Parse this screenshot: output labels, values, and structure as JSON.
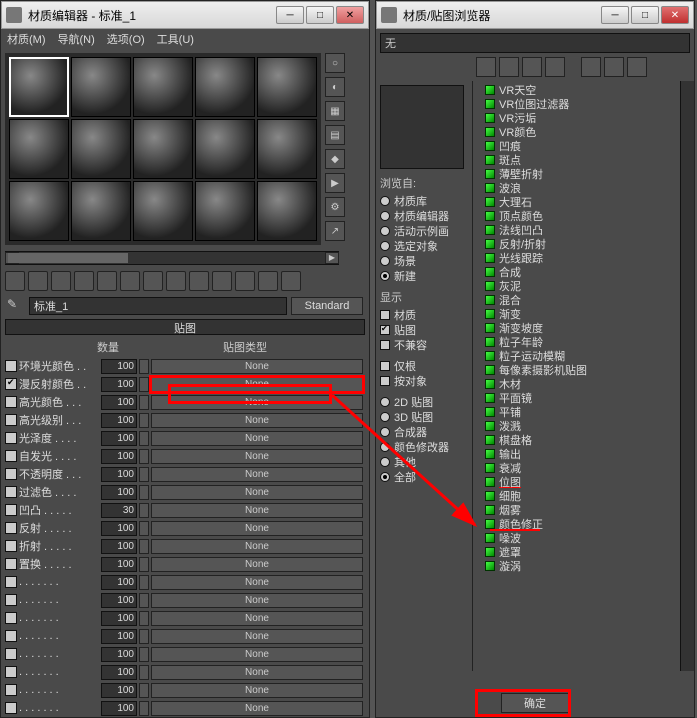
{
  "left": {
    "title": "材质编辑器 - 标准_1",
    "menus": [
      "材质(M)",
      "导航(N)",
      "选项(O)",
      "工具(U)"
    ],
    "material_name": "标准_1",
    "shader_button": "Standard",
    "section": "贴图",
    "col_amount": "数量",
    "col_type": "贴图类型",
    "maps": [
      {
        "label": "环境光颜色 . .",
        "amount": "100",
        "type": "None",
        "checked": false
      },
      {
        "label": "漫反射颜色 . .",
        "amount": "100",
        "type": "None",
        "checked": true,
        "highlight": true
      },
      {
        "label": "高光颜色 . . .",
        "amount": "100",
        "type": "None",
        "checked": false
      },
      {
        "label": "高光级别 . . .",
        "amount": "100",
        "type": "None",
        "checked": false
      },
      {
        "label": "光泽度 . . . .",
        "amount": "100",
        "type": "None",
        "checked": false
      },
      {
        "label": "自发光 . . . .",
        "amount": "100",
        "type": "None",
        "checked": false
      },
      {
        "label": "不透明度 . . .",
        "amount": "100",
        "type": "None",
        "checked": false
      },
      {
        "label": "过滤色 . . . .",
        "amount": "100",
        "type": "None",
        "checked": false
      },
      {
        "label": "凹凸 . . . . .",
        "amount": "30",
        "type": "None",
        "checked": false
      },
      {
        "label": "反射 . . . . .",
        "amount": "100",
        "type": "None",
        "checked": false
      },
      {
        "label": "折射 . . . . .",
        "amount": "100",
        "type": "None",
        "checked": false
      },
      {
        "label": "置换 . . . . .",
        "amount": "100",
        "type": "None",
        "checked": false
      },
      {
        "label": ". . . . . . .",
        "amount": "100",
        "type": "None",
        "checked": false
      },
      {
        "label": ". . . . . . .",
        "amount": "100",
        "type": "None",
        "checked": false
      },
      {
        "label": ". . . . . . .",
        "amount": "100",
        "type": "None",
        "checked": false
      },
      {
        "label": ". . . . . . .",
        "amount": "100",
        "type": "None",
        "checked": false
      },
      {
        "label": ". . . . . . .",
        "amount": "100",
        "type": "None",
        "checked": false
      },
      {
        "label": ". . . . . . .",
        "amount": "100",
        "type": "None",
        "checked": false
      },
      {
        "label": ". . . . . . .",
        "amount": "100",
        "type": "None",
        "checked": false
      },
      {
        "label": ". . . . . . .",
        "amount": "100",
        "type": "None",
        "checked": false
      }
    ]
  },
  "right": {
    "title": "材质/贴图浏览器",
    "search": "无",
    "browse_from": {
      "header": "浏览自:",
      "options": [
        {
          "label": "材质库",
          "on": false
        },
        {
          "label": "材质编辑器",
          "on": false
        },
        {
          "label": "活动示例画",
          "on": false
        },
        {
          "label": "选定对象",
          "on": false
        },
        {
          "label": "场景",
          "on": false
        },
        {
          "label": "新建",
          "on": true
        }
      ]
    },
    "show": {
      "header": "显示",
      "options": [
        {
          "label": "材质",
          "on": false
        },
        {
          "label": "贴图",
          "on": true
        },
        {
          "label": "不兼容",
          "on": false
        }
      ]
    },
    "root": {
      "header": "",
      "options": [
        {
          "label": "仅根",
          "on": false
        },
        {
          "label": "按对象",
          "on": false
        }
      ]
    },
    "filter": {
      "options": [
        {
          "label": "2D 贴图",
          "on": false
        },
        {
          "label": "3D 贴图",
          "on": false
        },
        {
          "label": "合成器",
          "on": false
        },
        {
          "label": "颜色修改器",
          "on": false
        },
        {
          "label": "其他",
          "on": false
        },
        {
          "label": "全部",
          "on": true
        }
      ]
    },
    "tree": [
      "VR天空",
      "VR位图过滤器",
      "VR污垢",
      "VR颜色",
      "凹痕",
      "斑点",
      "薄壁折射",
      "波浪",
      "大理石",
      "顶点颜色",
      "法线凹凸",
      "反射/折射",
      "光线跟踪",
      "合成",
      "灰泥",
      "混合",
      "渐变",
      "渐变坡度",
      "粒子年龄",
      "粒子运动模糊",
      "每像素摄影机贴图",
      "木材",
      "平面镜",
      "平铺",
      "泼溅",
      "棋盘格",
      "输出",
      "衰减",
      "位图",
      "细胞",
      "烟雾",
      "颜色修正",
      "噪波",
      "遮罩",
      "漩涡"
    ],
    "tree_highlight_index": 28,
    "ok": "确定"
  }
}
